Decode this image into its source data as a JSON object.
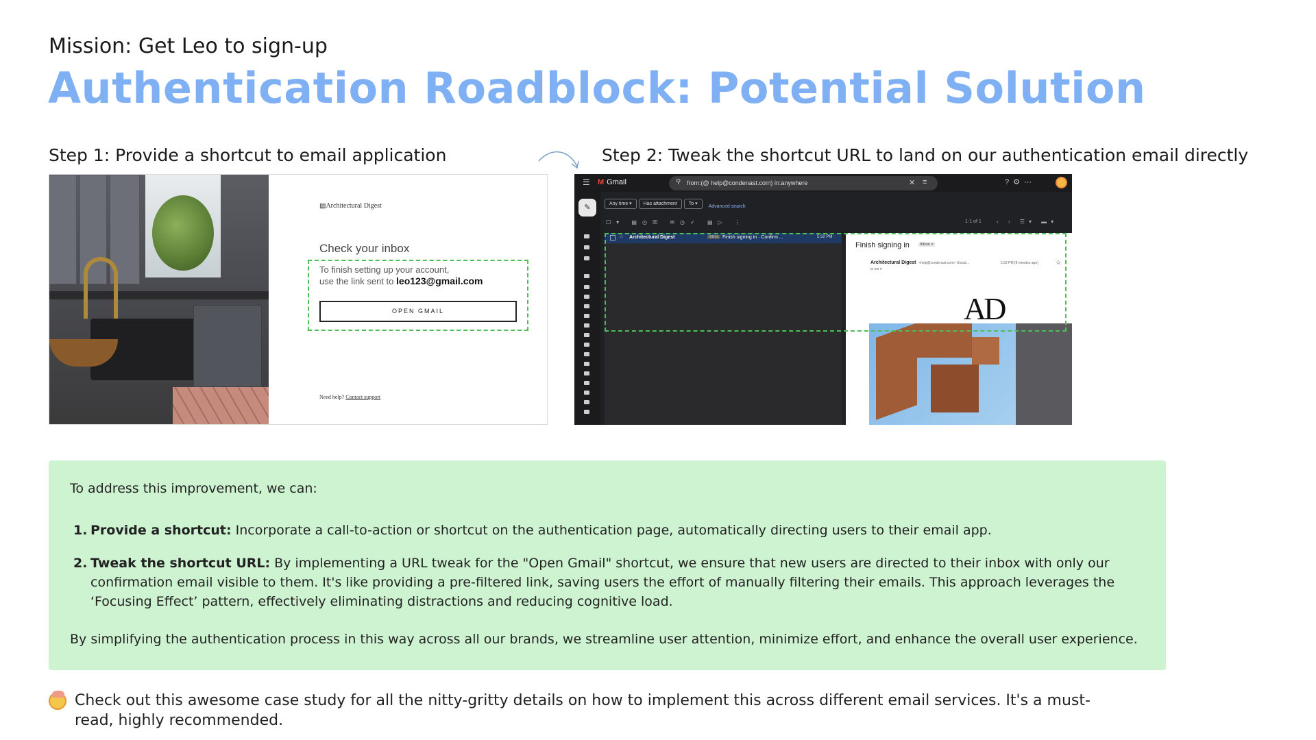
{
  "header": {
    "mission": "Mission: Get Leo to sign-up",
    "title": "Authentication Roadblock: Potential Solution"
  },
  "steps": {
    "step1_label": "Step 1: Provide a shortcut to email application",
    "step2_label": "Step 2: Tweak the shortcut URL to land on our authentication email directly"
  },
  "step1_screen": {
    "logo_alt": "Architectural Digest",
    "heading": "Check your inbox",
    "line1": "To finish setting up your account,",
    "line2_prefix": "use the link sent to ",
    "email": "leo123@gmail.com",
    "button": "OPEN GMAIL",
    "help_prefix": "Need help? ",
    "help_link": "Contact support"
  },
  "step2_screen": {
    "app_name": "Gmail",
    "search_query": "from:(@ help@condenast.com) in:anywhere",
    "chips": [
      "Any time ▾",
      "Has attachment",
      "To ▾"
    ],
    "advanced_search": "Advanced search",
    "count": "1-1 of 1",
    "row": {
      "sender": "Architectural Digest",
      "tag": "Inbox",
      "subject": "Finish signing in · Confirm ...",
      "time": "5:32 PM"
    },
    "reading": {
      "subject": "Finish signing in",
      "tag": "Inbox ×",
      "from": "Architectural Digest",
      "from_email": "<help@condenast.com> Unsub...",
      "time": "5:32 PM (8 minutes ago)",
      "to": "to me ▾",
      "logo": "AD"
    }
  },
  "solution": {
    "intro": "To address this improvement, we can:",
    "items": [
      {
        "num": "1.",
        "title": "Provide a shortcut:",
        "text": " Incorporate a call-to-action or shortcut on the authentication page, automatically directing users to their email app."
      },
      {
        "num": "2.",
        "title": "Tweak the shortcut URL:",
        "text": " By implementing a URL tweak for the \"Open Gmail\" shortcut, we ensure that new users are directed to their inbox with only our confirmation email visible to them. It's like providing a pre-filtered link, saving users the effort of manually filtering their emails. This approach leverages the ‘Focusing Effect’ pattern, effectively eliminating distractions and reducing cognitive load."
      }
    ],
    "closing": "By simplifying the authentication process in this way across all our brands, we streamline user attention, minimize effort, and enhance the overall user experience."
  },
  "footer": {
    "note": "Check out this awesome case study for all the nitty-gritty details on how to implement this across different email services. It's a must-read, highly recommended."
  },
  "colors": {
    "title": "#7fb0f3",
    "green_box": "#cdf3d1",
    "dashed_highlight": "#4cbf55",
    "gmail_dark": "#202124"
  }
}
